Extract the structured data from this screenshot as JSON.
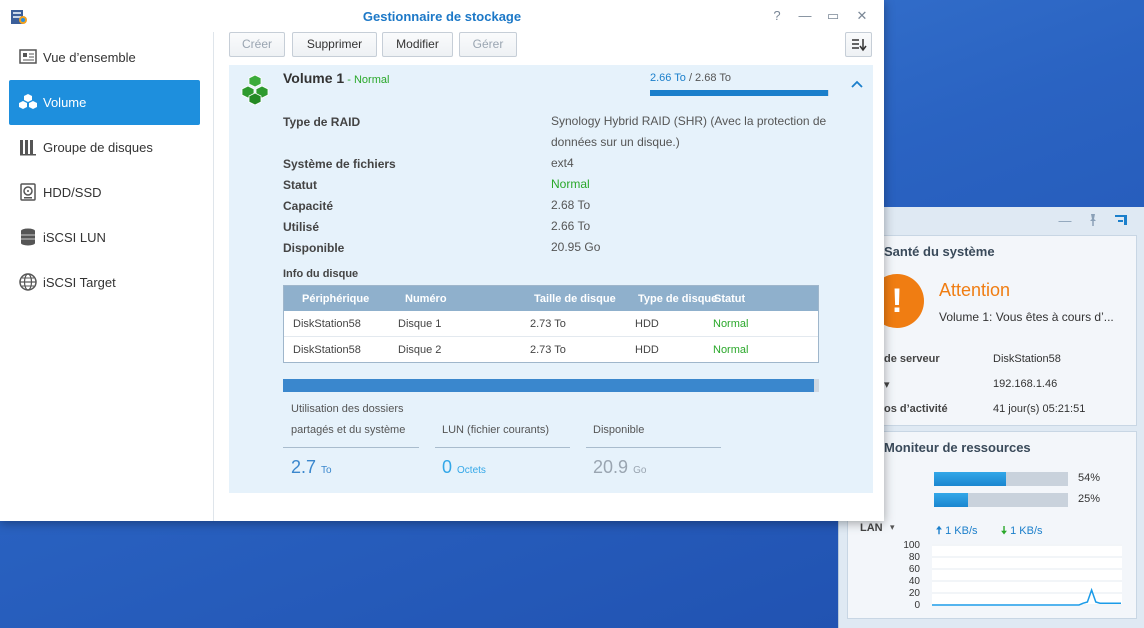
{
  "window": {
    "title": "Gestionnaire de stockage",
    "help_glyph": "?",
    "minimize_glyph": "—",
    "maximize_glyph": "▭",
    "close_glyph": "✕"
  },
  "sidebar": {
    "items": [
      {
        "label": "Vue d’ensemble",
        "icon": "overview-icon",
        "active": false
      },
      {
        "label": "Volume",
        "icon": "volume-icon",
        "active": true
      },
      {
        "label": "Groupe de disques",
        "icon": "disk-group-icon",
        "active": false
      },
      {
        "label": "HDD/SSD",
        "icon": "hdd-icon",
        "active": false
      },
      {
        "label": "iSCSI LUN",
        "icon": "iscsi-lun-icon",
        "active": false
      },
      {
        "label": "iSCSI Target",
        "icon": "iscsi-target-icon",
        "active": false
      }
    ]
  },
  "toolbar": {
    "create_label": "Créer",
    "delete_label": "Supprimer",
    "edit_label": "Modifier",
    "manage_label": "Gérer"
  },
  "volume": {
    "name": "Volume 1",
    "status_suffix": " - Normal",
    "used": "2.66 To",
    "total": " / 2.68 To",
    "usage_fraction": 0.9925,
    "properties": [
      {
        "label": "Type de RAID",
        "value": "Synology Hybrid RAID (SHR) (Avec la protection de données sur un disque.)"
      },
      {
        "label": "Système de fichiers",
        "value": "ext4"
      },
      {
        "label": "Statut",
        "value": "Normal"
      },
      {
        "label": "Capacité",
        "value": "2.68 To"
      },
      {
        "label": "Utilisé",
        "value": "2.66 To"
      },
      {
        "label": "Disponible",
        "value": "20.95 Go"
      }
    ],
    "disk_info_label": "Info du disque",
    "disk_table": {
      "headers": [
        "Périphérique",
        "Numéro",
        "Taille de disque",
        "Type de disque",
        "Statut"
      ],
      "rows": [
        [
          "DiskStation58",
          "Disque 1",
          "2.73 To",
          "HDD",
          "Normal"
        ],
        [
          "DiskStation58",
          "Disque 2",
          "2.73 To",
          "HDD",
          "Normal"
        ]
      ]
    },
    "storage_bar_fraction": 0.99,
    "stats": [
      {
        "label_line1": "Utilisation des dossiers",
        "label_line2": "partagés et du système",
        "value": "2.7",
        "unit": "To",
        "color": "#3a87cd"
      },
      {
        "label_line1": "",
        "label_line2": "LUN (fichier courants)",
        "value": "0",
        "unit": "Octets",
        "color": "#33a7e8"
      },
      {
        "label_line1": "",
        "label_line2": "Disponible",
        "value": "20.9",
        "unit": "Go",
        "color": "#9aa5b1"
      }
    ]
  },
  "health_widget": {
    "title": "Santé du système",
    "alert_glyph": "!",
    "alert_title": "Attention",
    "alert_message": "Volume 1: Vous êtes à cours d’...",
    "rows": [
      {
        "label": "de serveur",
        "value": "DiskStation58"
      },
      {
        "label": "▾",
        "value": "192.168.1.46"
      },
      {
        "label": "os d’activité",
        "value": "41 jour(s) 05:21:51"
      }
    ]
  },
  "monitor_widget": {
    "title": "Moniteur de ressources",
    "bars": [
      {
        "percent": 54,
        "label": "54%"
      },
      {
        "percent": 25,
        "label": "25%"
      }
    ],
    "lan_label": "LAN",
    "lan_caret": "▾",
    "upload": "1 KB/s",
    "download": "1 KB/s",
    "chart_data": {
      "type": "line",
      "y_ticks": [
        "100",
        "80",
        "60",
        "40",
        "20",
        "0"
      ],
      "ylim": [
        0,
        100
      ],
      "series": [
        {
          "values": [
            0,
            0,
            0,
            0,
            0,
            0,
            0,
            0,
            0,
            0,
            0,
            0,
            0,
            0,
            0,
            0,
            0,
            0,
            0,
            0,
            0,
            0,
            0,
            0,
            0,
            0,
            0,
            0,
            0,
            0,
            0,
            0,
            0,
            0,
            0,
            0,
            3,
            5,
            25,
            5,
            3,
            3,
            3,
            3,
            3,
            3
          ],
          "color": "#1b9be8"
        }
      ]
    }
  }
}
